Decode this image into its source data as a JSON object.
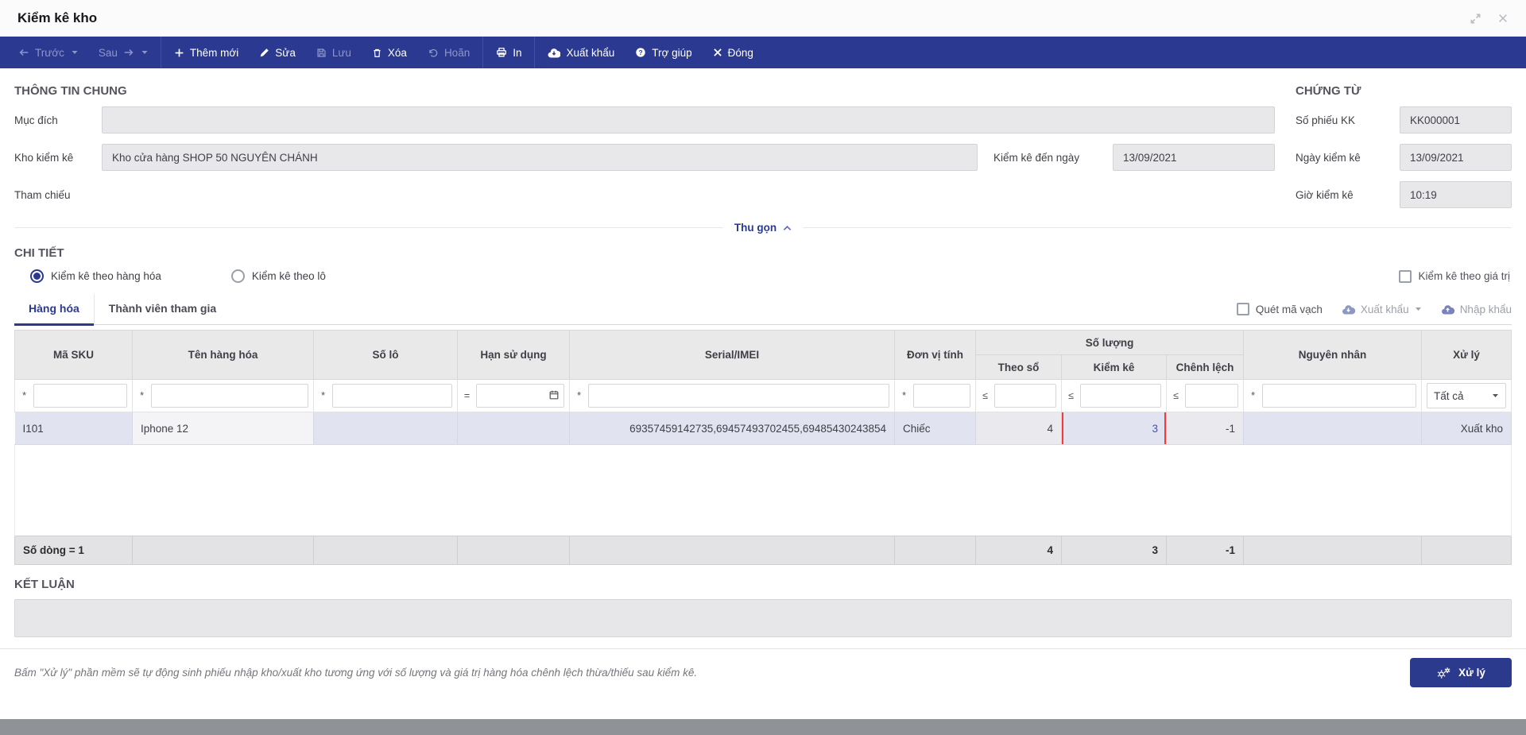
{
  "window": {
    "title": "Kiểm kê kho"
  },
  "toolbar": {
    "items": [
      {
        "label": "Trước"
      },
      {
        "label": "Sau"
      },
      {
        "label": "Thêm mới"
      },
      {
        "label": "Sửa"
      },
      {
        "label": "Lưu"
      },
      {
        "label": "Xóa"
      },
      {
        "label": "Hoãn"
      },
      {
        "label": "In"
      },
      {
        "label": "Xuất khẩu"
      },
      {
        "label": "Trợ giúp"
      },
      {
        "label": "Đóng"
      }
    ]
  },
  "general": {
    "heading": "THÔNG TIN CHUNG",
    "purpose_label": "Mục đích",
    "warehouse_label": "Kho kiểm kê",
    "warehouse_value": "Kho cửa hàng SHOP 50 NGUYÊN CHÁNH",
    "count_to_date_label": "Kiểm kê đến ngày",
    "count_to_date_value": "13/09/2021",
    "reference_label": "Tham chiếu"
  },
  "document": {
    "heading": "CHỨNG TỪ",
    "sheet_label": "Số phiếu KK",
    "sheet_value": "KK000001",
    "date_label": "Ngày kiểm kê",
    "date_value": "13/09/2021",
    "time_label": "Giờ kiểm kê",
    "time_value": "10:19"
  },
  "collapse": {
    "label": "Thu gọn"
  },
  "detail": {
    "heading": "CHI TIẾT",
    "radio_by_product": "Kiểm kê theo hàng hóa",
    "radio_by_lot": "Kiểm kê theo lô",
    "checkbox_by_value": "Kiểm kê theo giá trị",
    "tabs": [
      {
        "label": "Hàng hóa"
      },
      {
        "label": "Thành viên tham gia"
      }
    ],
    "scan_barcode_label": "Quét mã vạch",
    "export_label": "Xuất khẩu",
    "import_label": "Nhập khẩu"
  },
  "table": {
    "headers": [
      "Mã SKU",
      "Tên hàng hóa",
      "Số lô",
      "Hạn sử dụng",
      "Serial/IMEI",
      "Đơn vị tính"
    ],
    "qty_group": "Số lượng",
    "qty_sub": [
      "Theo sổ",
      "Kiểm kê",
      "Chênh lệch"
    ],
    "tail_headers": [
      "Nguyên nhân",
      "Xử lý"
    ],
    "ops": {
      "contains": "*",
      "equals": "=",
      "lte": "≤"
    },
    "filter_action_value": "Tất cả",
    "rows": [
      {
        "sku": "I101",
        "name": "Iphone 12",
        "lot": "",
        "expiry": "",
        "serial": "69357459142735,69457493702455,69485430243854",
        "unit": "Chiếc",
        "book_qty": "4",
        "counted_qty": "3",
        "diff_qty": "-1",
        "reason": "",
        "action": "Xuất kho"
      }
    ],
    "summary": {
      "label": "Số dòng = 1",
      "book_total": "4",
      "counted_total": "3",
      "diff_total": "-1"
    }
  },
  "conclusion": {
    "heading": "KẾT LUẬN"
  },
  "bottombar": {
    "note": "Bấm \"Xử lý\" phần mềm sẽ tự động sinh phiếu nhập kho/xuất kho tương ứng với số lượng và giá trị hàng hóa chênh lệch thừa/thiếu sau kiểm kê.",
    "process_label": "Xử lý"
  },
  "colors": {
    "accent": "#2b3990",
    "highlight_red": "#f23b3b",
    "selected_row": "#e2e3f1",
    "counted_value": "#4150b5"
  }
}
